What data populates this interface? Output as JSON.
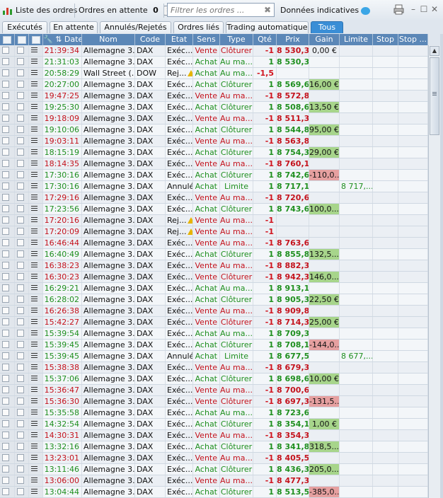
{
  "toolbar": {
    "orders_list_label": "Liste des ordres",
    "pending_label": "Ordres en attente",
    "pending_count": "0",
    "filter_placeholder": "Filtrer les ordres ...",
    "indicative_label": "Données indicatives"
  },
  "tabs": [
    "Exécutés",
    "En attente",
    "Annulés/Rejetés",
    "Ordres liés",
    "Trading automatique",
    "Tous"
  ],
  "active_tab": "Tous",
  "columns": [
    "Date",
    "Nom",
    "Code",
    "Etat",
    "Sens",
    "Type",
    "Qté",
    "Prix",
    "Gain",
    "Limite",
    "Stop",
    "Stop ..."
  ],
  "rows": [
    {
      "time": "21:39:34",
      "name": "Allemagne 3...",
      "code": "DAX",
      "state": "Exéc...",
      "side": "Vente",
      "type": "Clôturer",
      "qty": "-1",
      "price": "8 530,3",
      "gain": "0,00 €",
      "gain_sign": "zero",
      "limit": ""
    },
    {
      "time": "21:31:03",
      "name": "Allemagne 3...",
      "code": "DAX",
      "state": "Exéc...",
      "side": "Achat",
      "type": "Au ma...",
      "qty": "1",
      "price": "8 530,3",
      "gain": "",
      "gain_sign": "",
      "limit": ""
    },
    {
      "time": "20:58:29",
      "name": "Wall Street (...",
      "code": "DOW",
      "state": "Rej...",
      "warn": true,
      "side": "Achat",
      "type": "Au ma...",
      "qty": "-1,5",
      "price": "",
      "gain": "",
      "gain_sign": "",
      "limit": ""
    },
    {
      "time": "20:27:00",
      "name": "Allemagne 3...",
      "code": "DAX",
      "state": "Exéc...",
      "side": "Achat",
      "type": "Clôturer",
      "qty": "1",
      "price": "8 569,6",
      "gain": "16,00 €",
      "gain_sign": "pos",
      "limit": ""
    },
    {
      "time": "19:47:25",
      "name": "Allemagne 3...",
      "code": "DAX",
      "state": "Exéc...",
      "side": "Vente",
      "type": "Au ma...",
      "qty": "-1",
      "price": "8 572,8",
      "gain": "",
      "gain_sign": "",
      "limit": ""
    },
    {
      "time": "19:25:30",
      "name": "Allemagne 3...",
      "code": "DAX",
      "state": "Exéc...",
      "side": "Achat",
      "type": "Clôturer",
      "qty": "1",
      "price": "8 508,6",
      "gain": "13,50 €",
      "gain_sign": "pos",
      "limit": ""
    },
    {
      "time": "19:18:09",
      "name": "Allemagne 3...",
      "code": "DAX",
      "state": "Exéc...",
      "side": "Vente",
      "type": "Au ma...",
      "qty": "-1",
      "price": "8 511,3",
      "gain": "",
      "gain_sign": "",
      "limit": ""
    },
    {
      "time": "19:10:06",
      "name": "Allemagne 3...",
      "code": "DAX",
      "state": "Exéc...",
      "side": "Achat",
      "type": "Clôturer",
      "qty": "1",
      "price": "8 544,8",
      "gain": "95,00 €",
      "gain_sign": "pos",
      "limit": ""
    },
    {
      "time": "19:03:11",
      "name": "Allemagne 3...",
      "code": "DAX",
      "state": "Exéc...",
      "side": "Vente",
      "type": "Au ma...",
      "qty": "-1",
      "price": "8 563,8",
      "gain": "",
      "gain_sign": "",
      "limit": ""
    },
    {
      "time": "18:15:19",
      "name": "Allemagne 3...",
      "code": "DAX",
      "state": "Exéc...",
      "side": "Achat",
      "type": "Clôturer",
      "qty": "1",
      "price": "8 754,3",
      "gain": "29,00 €",
      "gain_sign": "pos",
      "limit": ""
    },
    {
      "time": "18:14:35",
      "name": "Allemagne 3...",
      "code": "DAX",
      "state": "Exéc...",
      "side": "Vente",
      "type": "Au ma...",
      "qty": "-1",
      "price": "8 760,1",
      "gain": "",
      "gain_sign": "",
      "limit": ""
    },
    {
      "time": "17:30:16",
      "name": "Allemagne 3...",
      "code": "DAX",
      "state": "Exéc...",
      "side": "Achat",
      "type": "Clôturer",
      "qty": "1",
      "price": "8 742,6",
      "gain": "-110,0...",
      "gain_sign": "neg",
      "limit": ""
    },
    {
      "time": "17:30:16",
      "name": "Allemagne 3...",
      "code": "DAX",
      "state": "Annulé",
      "side": "Achat",
      "type": "Limite",
      "qty": "1",
      "price": "8 717,1",
      "gain": "",
      "gain_sign": "",
      "limit": "8 717,..."
    },
    {
      "time": "17:29:16",
      "name": "Allemagne 3...",
      "code": "DAX",
      "state": "Exéc...",
      "side": "Vente",
      "type": "Au ma...",
      "qty": "-1",
      "price": "8 720,6",
      "gain": "",
      "gain_sign": "",
      "limit": ""
    },
    {
      "time": "17:23:56",
      "name": "Allemagne 3...",
      "code": "DAX",
      "state": "Exéc...",
      "side": "Achat",
      "type": "Clôturer",
      "qty": "1",
      "price": "8 743,6",
      "gain": "100,0...",
      "gain_sign": "pos",
      "limit": ""
    },
    {
      "time": "17:20:16",
      "name": "Allemagne 3...",
      "code": "DAX",
      "state": "Rej...",
      "warn": true,
      "side": "Vente",
      "type": "Au ma...",
      "qty": "-1",
      "price": "",
      "gain": "",
      "gain_sign": "",
      "limit": ""
    },
    {
      "time": "17:20:09",
      "name": "Allemagne 3...",
      "code": "DAX",
      "state": "Rej...",
      "warn": true,
      "side": "Vente",
      "type": "Au ma...",
      "qty": "-1",
      "price": "",
      "gain": "",
      "gain_sign": "",
      "limit": ""
    },
    {
      "time": "16:46:44",
      "name": "Allemagne 3...",
      "code": "DAX",
      "state": "Exéc...",
      "side": "Vente",
      "type": "Au ma...",
      "qty": "-1",
      "price": "8 763,6",
      "gain": "",
      "gain_sign": "",
      "limit": ""
    },
    {
      "time": "16:40:49",
      "name": "Allemagne 3...",
      "code": "DAX",
      "state": "Exéc...",
      "side": "Achat",
      "type": "Clôturer",
      "qty": "1",
      "price": "8 855,8",
      "gain": "132,5...",
      "gain_sign": "pos",
      "limit": ""
    },
    {
      "time": "16:38:23",
      "name": "Allemagne 3...",
      "code": "DAX",
      "state": "Exéc...",
      "side": "Vente",
      "type": "Au ma...",
      "qty": "-1",
      "price": "8 882,3",
      "gain": "",
      "gain_sign": "",
      "limit": ""
    },
    {
      "time": "16:30:23",
      "name": "Allemagne 3...",
      "code": "DAX",
      "state": "Exéc...",
      "side": "Vente",
      "type": "Clôturer",
      "qty": "-1",
      "price": "8 942,3",
      "gain": "146,0...",
      "gain_sign": "pos",
      "limit": ""
    },
    {
      "time": "16:29:21",
      "name": "Allemagne 3...",
      "code": "DAX",
      "state": "Exéc...",
      "side": "Achat",
      "type": "Au ma...",
      "qty": "1",
      "price": "8 913,1",
      "gain": "",
      "gain_sign": "",
      "limit": ""
    },
    {
      "time": "16:28:02",
      "name": "Allemagne 3...",
      "code": "DAX",
      "state": "Exéc...",
      "side": "Achat",
      "type": "Clôturer",
      "qty": "1",
      "price": "8 905,3",
      "gain": "22,50 €",
      "gain_sign": "pos",
      "limit": ""
    },
    {
      "time": "16:26:38",
      "name": "Allemagne 3...",
      "code": "DAX",
      "state": "Exéc...",
      "side": "Vente",
      "type": "Au ma...",
      "qty": "-1",
      "price": "8 909,8",
      "gain": "",
      "gain_sign": "",
      "limit": ""
    },
    {
      "time": "15:42:27",
      "name": "Allemagne 3...",
      "code": "DAX",
      "state": "Exéc...",
      "side": "Vente",
      "type": "Clôturer",
      "qty": "-1",
      "price": "8 714,3",
      "gain": "25,00 €",
      "gain_sign": "pos",
      "limit": ""
    },
    {
      "time": "15:39:54",
      "name": "Allemagne 3...",
      "code": "DAX",
      "state": "Exéc...",
      "side": "Achat",
      "type": "Au ma...",
      "qty": "1",
      "price": "8 709,3",
      "gain": "",
      "gain_sign": "",
      "limit": ""
    },
    {
      "time": "15:39:45",
      "name": "Allemagne 3...",
      "code": "DAX",
      "state": "Exéc...",
      "side": "Achat",
      "type": "Clôturer",
      "qty": "1",
      "price": "8 708,1",
      "gain": "-144,0...",
      "gain_sign": "neg",
      "limit": ""
    },
    {
      "time": "15:39:45",
      "name": "Allemagne 3...",
      "code": "DAX",
      "state": "Annulé",
      "side": "Achat",
      "type": "Limite",
      "qty": "1",
      "price": "8 677,5",
      "gain": "",
      "gain_sign": "",
      "limit": "8 677,..."
    },
    {
      "time": "15:38:38",
      "name": "Allemagne 3...",
      "code": "DAX",
      "state": "Exéc...",
      "side": "Vente",
      "type": "Au ma...",
      "qty": "-1",
      "price": "8 679,3",
      "gain": "",
      "gain_sign": "",
      "limit": ""
    },
    {
      "time": "15:37:06",
      "name": "Allemagne 3...",
      "code": "DAX",
      "state": "Exéc...",
      "side": "Achat",
      "type": "Clôturer",
      "qty": "1",
      "price": "8 698,6",
      "gain": "10,00 €",
      "gain_sign": "pos",
      "limit": ""
    },
    {
      "time": "15:36:47",
      "name": "Allemagne 3...",
      "code": "DAX",
      "state": "Exéc...",
      "side": "Vente",
      "type": "Au ma...",
      "qty": "-1",
      "price": "8 700,6",
      "gain": "",
      "gain_sign": "",
      "limit": ""
    },
    {
      "time": "15:36:30",
      "name": "Allemagne 3...",
      "code": "DAX",
      "state": "Exéc...",
      "side": "Vente",
      "type": "Clôturer",
      "qty": "-1",
      "price": "8 697,3",
      "gain": "-131,5...",
      "gain_sign": "neg",
      "limit": ""
    },
    {
      "time": "15:35:58",
      "name": "Allemagne 3...",
      "code": "DAX",
      "state": "Exéc...",
      "side": "Achat",
      "type": "Au ma...",
      "qty": "1",
      "price": "8 723,6",
      "gain": "",
      "gain_sign": "",
      "limit": ""
    },
    {
      "time": "14:32:54",
      "name": "Allemagne 3...",
      "code": "DAX",
      "state": "Exéc...",
      "side": "Achat",
      "type": "Clôturer",
      "qty": "1",
      "price": "8 354,1",
      "gain": "1,00 €",
      "gain_sign": "pos",
      "limit": ""
    },
    {
      "time": "14:30:31",
      "name": "Allemagne 3...",
      "code": "DAX",
      "state": "Exéc...",
      "side": "Vente",
      "type": "Au ma...",
      "qty": "-1",
      "price": "8 354,3",
      "gain": "",
      "gain_sign": "",
      "limit": ""
    },
    {
      "time": "13:32:16",
      "name": "Allemagne 3...",
      "code": "DAX",
      "state": "Exéc...",
      "side": "Achat",
      "type": "Clôturer",
      "qty": "1",
      "price": "8 341,8",
      "gain": "318,5...",
      "gain_sign": "pos",
      "limit": ""
    },
    {
      "time": "13:23:01",
      "name": "Allemagne 3...",
      "code": "DAX",
      "state": "Exéc...",
      "side": "Vente",
      "type": "Au ma...",
      "qty": "-1",
      "price": "8 405,5",
      "gain": "",
      "gain_sign": "",
      "limit": ""
    },
    {
      "time": "13:11:46",
      "name": "Allemagne 3...",
      "code": "DAX",
      "state": "Exéc...",
      "side": "Achat",
      "type": "Clôturer",
      "qty": "1",
      "price": "8 436,3",
      "gain": "205,0...",
      "gain_sign": "pos",
      "limit": ""
    },
    {
      "time": "13:06:00",
      "name": "Allemagne 3...",
      "code": "DAX",
      "state": "Exéc...",
      "side": "Vente",
      "type": "Au ma...",
      "qty": "-1",
      "price": "8 477,3",
      "gain": "",
      "gain_sign": "",
      "limit": ""
    },
    {
      "time": "13:04:44",
      "name": "Allemagne 3...",
      "code": "DAX",
      "state": "Exéc...",
      "side": "Achat",
      "type": "Clôturer",
      "qty": "1",
      "price": "8 513,5",
      "gain": "-385,0...",
      "gain_sign": "neg",
      "limit": ""
    }
  ],
  "colors": {
    "sell": "#c4121c",
    "buy": "#1f8f1f",
    "header": "#5b87b7",
    "active_tab": "#3a8ed6",
    "gain_pos": "#a7d58b",
    "gain_neg": "#e6a0a0"
  }
}
